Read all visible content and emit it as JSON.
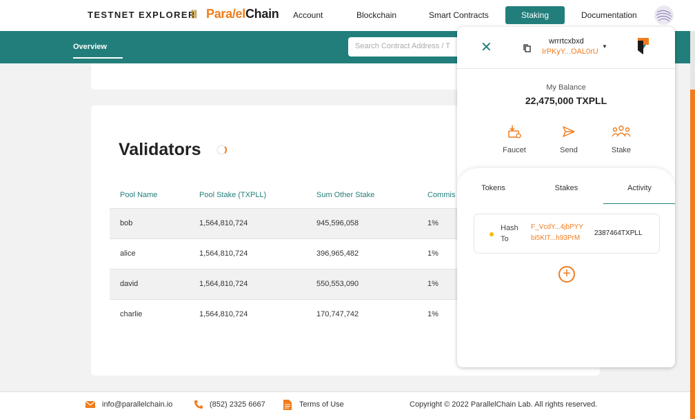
{
  "header": {
    "brand": "TESTNET EXPLORER",
    "separator": "|||",
    "logo_part1": "Para",
    "logo_part2": "/el",
    "logo_part3": "Chain",
    "nav": [
      "Account",
      "Blockchain",
      "Smart Contracts",
      "Staking",
      "Documentation"
    ],
    "active_nav": "Staking"
  },
  "subheader": {
    "tab": "Overview",
    "search_placeholder": "Search Contract Address / T"
  },
  "validators": {
    "title": "Validators",
    "columns": [
      "Pool Name",
      "Pool Stake (TXPLL)",
      "Sum Other Stake",
      "Commis"
    ],
    "rows": [
      [
        "bob",
        "1,564,810,724",
        "945,596,058",
        "1%"
      ],
      [
        "alice",
        "1,564,810,724",
        "396,965,482",
        "1%"
      ],
      [
        "david",
        "1,564,810,724",
        "550,553,090",
        "1%"
      ],
      [
        "charlie",
        "1,564,810,724",
        "170,747,742",
        "1%"
      ]
    ]
  },
  "wallet": {
    "account_name": "wrrrtcxbxd",
    "account_address": "IrPKyY...OAL0rU",
    "balance_label": "My Balance",
    "balance": "22,475,000 TXPLL",
    "actions": [
      "Faucet",
      "Send",
      "Stake"
    ],
    "tabs": [
      "Tokens",
      "Stakes",
      "Activity"
    ],
    "active_tab": "Activity",
    "activity": {
      "label1": "Hash",
      "label2": "To",
      "hash": "F_VcdY...4jbPYY",
      "to": "bi5KIT...h93PrM",
      "amount": "2387464TXPLL"
    },
    "add_button": "+"
  },
  "footer": {
    "email": "info@parallelchain.io",
    "phone": "(852) 2325 6667",
    "terms": "Terms of Use",
    "copyright": "Copyright © 2022 ParallelChain Lab. All rights reserved."
  },
  "colors": {
    "teal": "#227e7b",
    "orange": "#f07c1c"
  }
}
